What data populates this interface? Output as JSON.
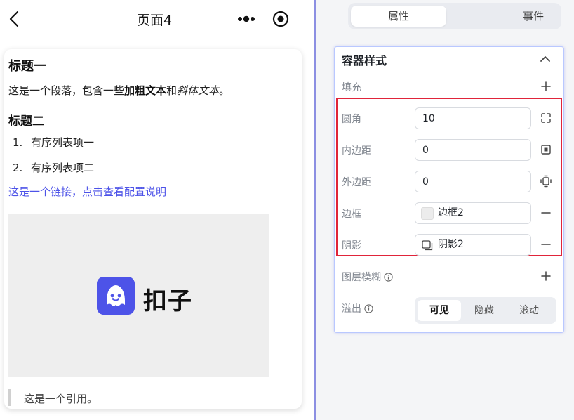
{
  "phone": {
    "title": "页面4",
    "content": {
      "heading1": "标题一",
      "paragraph": {
        "prefix": "这是一个段落，包含一些",
        "bold": "加粗文本",
        "middle": "和",
        "italic": "斜体文本",
        "suffix": "。"
      },
      "heading2": "标题二",
      "ordered_list": [
        {
          "num": "1.",
          "text": "有序列表项一"
        },
        {
          "num": "2.",
          "text": "有序列表项二"
        }
      ],
      "link": "这是一个链接，点击查看配置说明",
      "image_logo_text": "扣子",
      "quote": "这是一个引用。"
    }
  },
  "panel": {
    "tabs": [
      {
        "label": "属性",
        "active": true
      },
      {
        "label": "事件",
        "active": false
      }
    ],
    "section_title": "容器样式",
    "fill_label": "填充",
    "radius": {
      "label": "圆角",
      "value": "10"
    },
    "padding": {
      "label": "内边距",
      "value": "0"
    },
    "margin": {
      "label": "外边距",
      "value": "0"
    },
    "border": {
      "label": "边框",
      "value": "边框2"
    },
    "shadow": {
      "label": "阴影",
      "value": "阴影2"
    },
    "layer_blur_label": "图层模糊",
    "overflow": {
      "label": "溢出",
      "options": [
        "可见",
        "隐藏",
        "滚动"
      ],
      "selected": "可见"
    }
  },
  "colors": {
    "accent": "#4d53e8",
    "highlight_border": "#e0243a",
    "panel_bg": "#f4f5f7"
  }
}
